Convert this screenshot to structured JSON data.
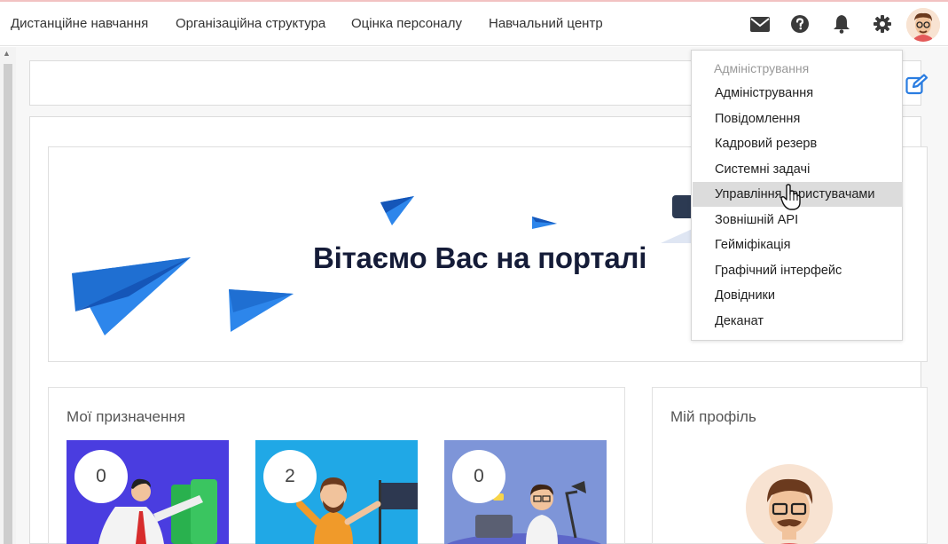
{
  "topnav": {
    "items": [
      {
        "label": "Дистанційне навчання"
      },
      {
        "label": "Організаційна структура"
      },
      {
        "label": "Оцінка персоналу"
      },
      {
        "label": "Навчальний центр"
      }
    ],
    "icons": [
      "envelope-icon",
      "question-circle-icon",
      "bell-icon",
      "gear-icon"
    ]
  },
  "hero": {
    "title": "Вітаємо Вас на порталі"
  },
  "assignments": {
    "title": "Мої призначення",
    "tiles": [
      {
        "count": "0",
        "bg": "#4b3fe0"
      },
      {
        "count": "2",
        "bg": "#1fa9e6"
      },
      {
        "count": "0",
        "bg": "#7f95d9"
      }
    ]
  },
  "profile": {
    "title": "Мій профіль"
  },
  "admin_menu": {
    "header": "Адміністрування",
    "items": [
      {
        "label": "Адміністрування"
      },
      {
        "label": "Повідомлення"
      },
      {
        "label": "Кадровий резерв"
      },
      {
        "label": "Системні задачі"
      },
      {
        "label": "Управління користувачами"
      },
      {
        "label": "Зовнішній API"
      },
      {
        "label": "Гейміфікація"
      },
      {
        "label": "Графічний інтерфейс"
      },
      {
        "label": "Довідники"
      },
      {
        "label": "Деканат"
      }
    ]
  },
  "colors": {
    "accent": "#2a7de1",
    "paper_plane": "#2d86eb",
    "paper_plane_dark": "#1556b8",
    "hero_text": "#151c38"
  }
}
